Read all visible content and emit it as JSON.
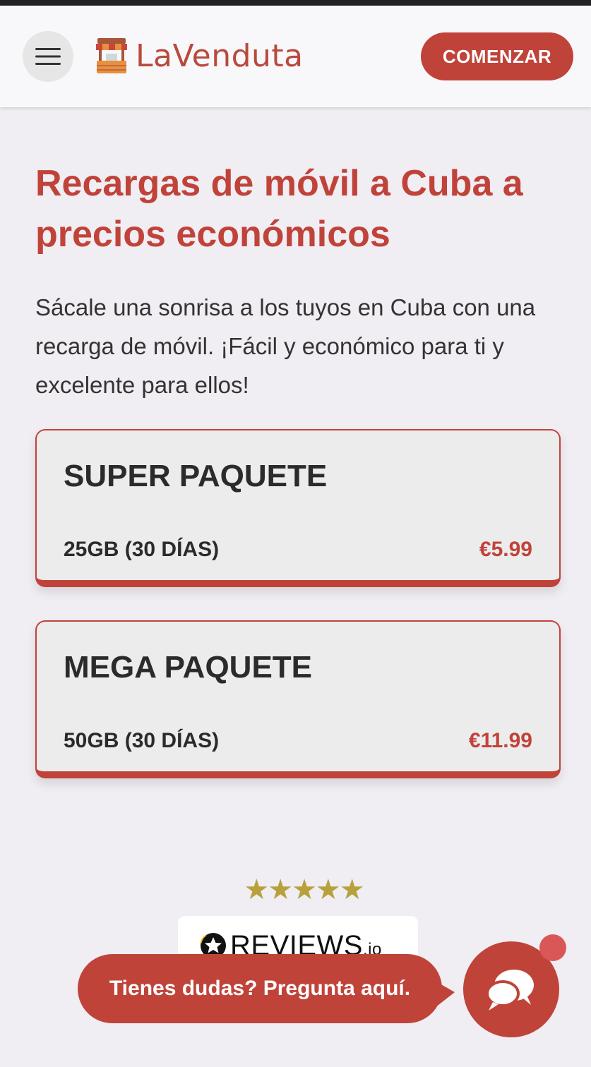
{
  "header": {
    "brand": "LaVenduta",
    "cta_label": "COMENZAR",
    "menu_icon": "hamburger-menu-icon",
    "logo_icon": "market-stall-icon"
  },
  "hero": {
    "title": "Recargas de móvil a Cuba a precios económicos",
    "description": "Sácale una sonrisa a los tuyos en Cuba con una recarga de móvil. ¡Fácil y económico para ti y excelente para ellos!"
  },
  "packages": [
    {
      "name": "SUPER PAQUETE",
      "detail": "25GB (30 DÍAS)",
      "price": "€5.99"
    },
    {
      "name": "MEGA PAQUETE",
      "detail": "50GB (30 DÍAS)",
      "price": "€11.99"
    }
  ],
  "reviews": {
    "stars": "★★★★★",
    "rating": 5,
    "brand_main": "REVIEWS",
    "brand_suffix": ".io"
  },
  "chat": {
    "prompt": "Tienes dudas? Pregunta aquí.",
    "icon": "chat-bubbles-icon"
  },
  "colors": {
    "accent": "#c0433a",
    "background": "#f0edf3",
    "header_bg": "#f8f8fb",
    "star": "#b8a13d"
  }
}
